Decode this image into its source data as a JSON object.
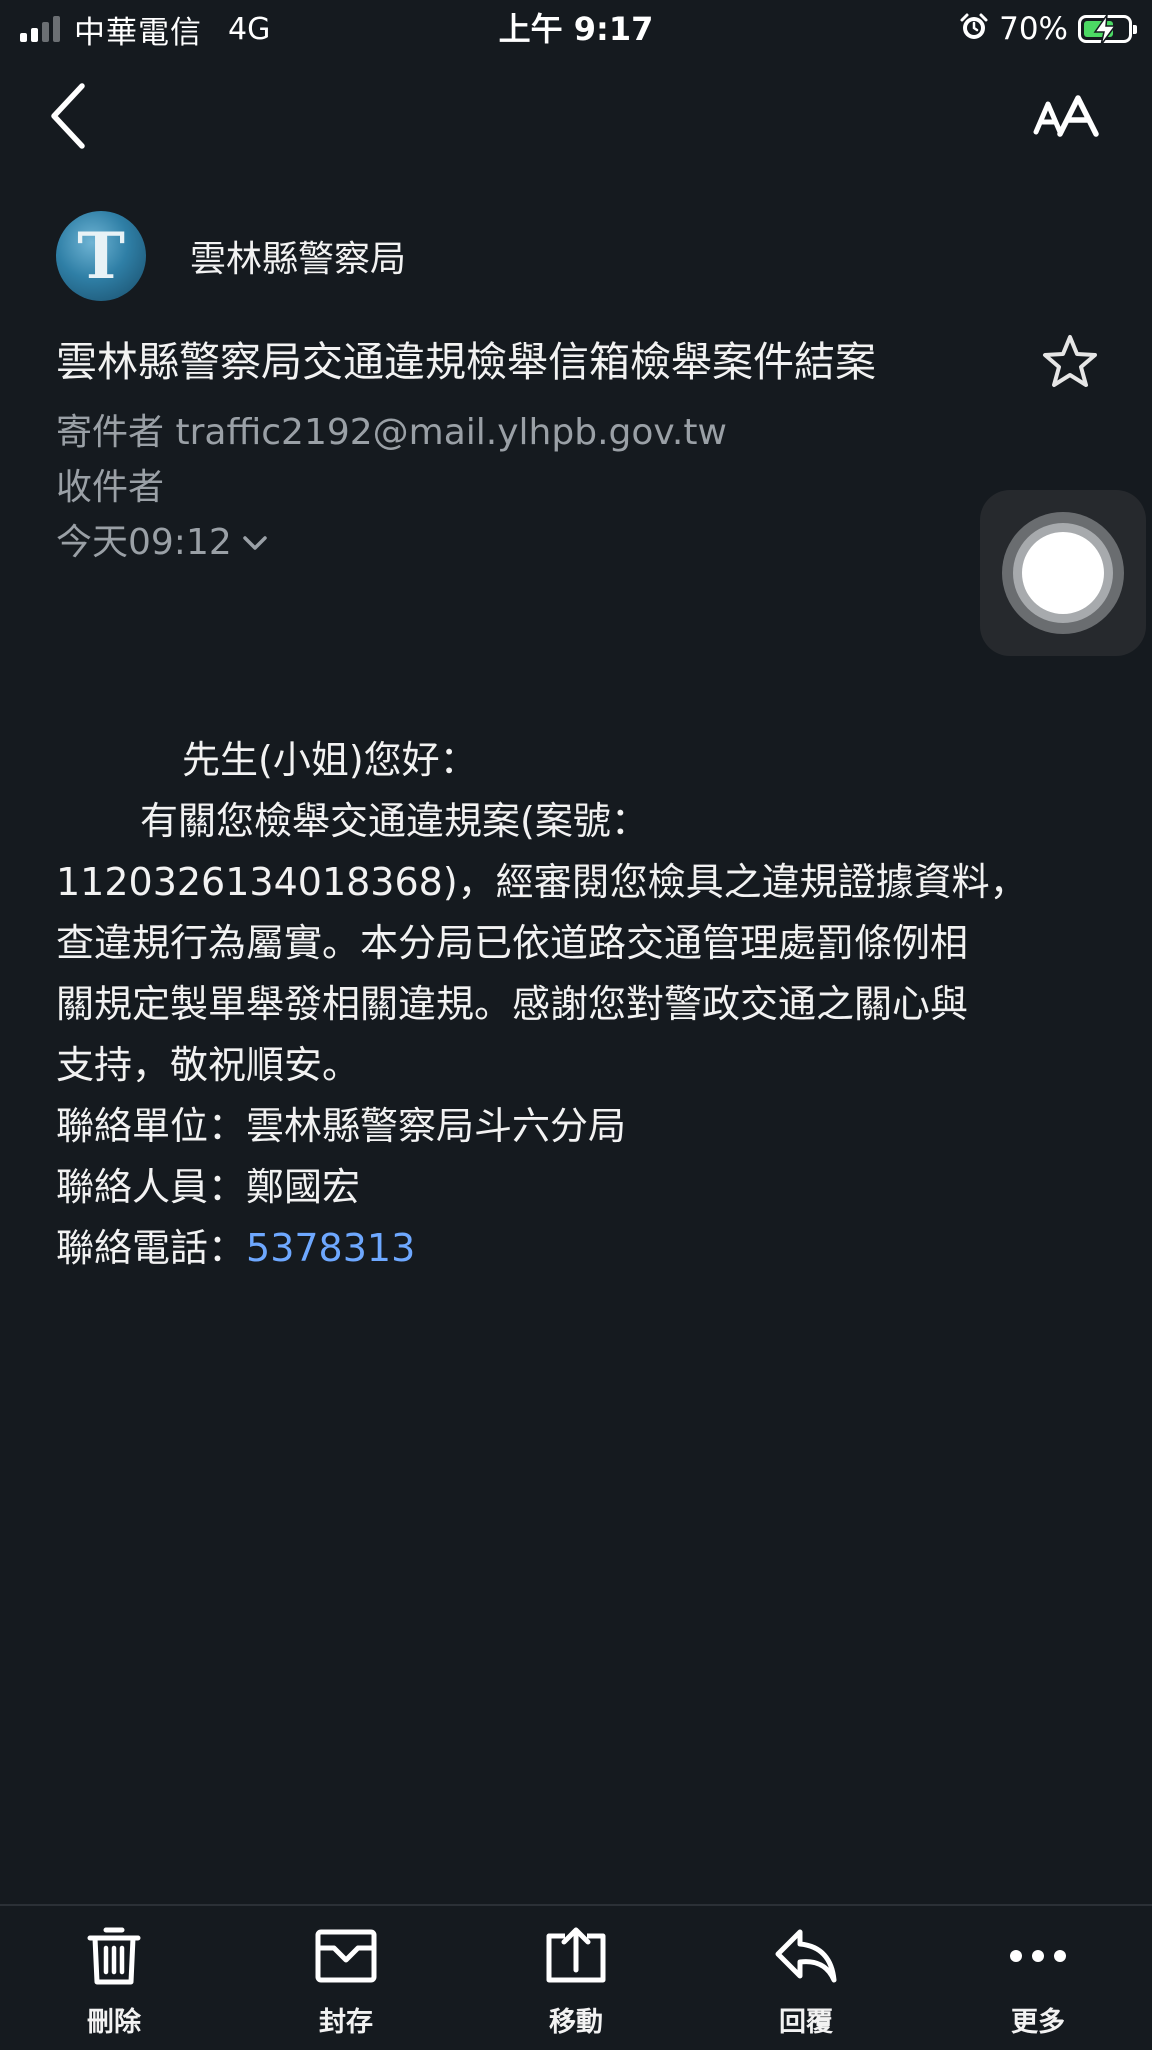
{
  "status_bar": {
    "carrier": "中華電信",
    "network": "4G",
    "time": "上午 9:17",
    "battery_percent": "70%",
    "battery_level": 0.7,
    "icons": [
      "signal-icon",
      "alarm-icon",
      "battery-charging-icon"
    ]
  },
  "nav": {
    "back_icon": "chevron-left-icon",
    "text_size_label": "AA"
  },
  "email": {
    "avatar_letter": "T",
    "sender_name": "雲林縣警察局",
    "subject": "雲林縣警察局交通違規檢舉信箱檢舉案件結案",
    "from_label": "寄件者",
    "from_address": "traffic2192@mail.ylhpb.gov.tw",
    "to_label": "收件者",
    "date": "今天09:12",
    "body": {
      "greeting": "先生(小姐)您好：",
      "line1": "有關您檢舉交通違規案(案號：",
      "line2": "1120326134018368)，經審閱您檢具之違規證據資料，",
      "line3": "查違規行為屬實。本分局已依道路交通管理處罰條例相",
      "line4": "關規定製單舉發相關違規。感謝您對警政交通之關心與",
      "line5": "支持，敬祝順安。",
      "contact_unit": "聯絡單位：雲林縣警察局斗六分局",
      "contact_person": "聯絡人員：鄭國宏",
      "contact_phone_label": "聯絡電話：",
      "contact_phone": "5378313"
    }
  },
  "toolbar": {
    "delete_label": "刪除",
    "archive_label": "封存",
    "move_label": "移動",
    "reply_label": "回覆",
    "more_label": "更多"
  },
  "colors": {
    "background": "#151a1f",
    "link": "#6ea8ff",
    "secondary_text": "#9aa0a6",
    "battery_fill": "#4cd964"
  }
}
